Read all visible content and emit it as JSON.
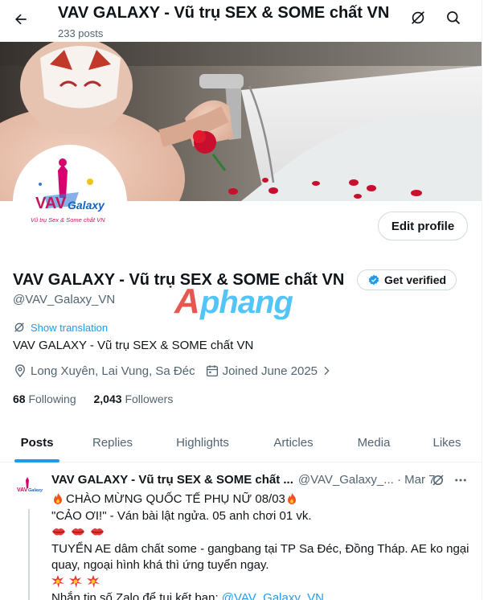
{
  "header": {
    "title": "VAV GALAXY - Vũ trụ SEX & SOME chất VN",
    "post_count": "233 posts"
  },
  "profile": {
    "name": "VAV GALAXY - Vũ trụ SEX & SOME chất VN",
    "handle": "@VAV_Galaxy_VN",
    "edit_label": "Edit profile",
    "get_verified_label": "Get verified",
    "show_translation": "Show translation",
    "bio": "VAV GALAXY - Vũ trụ SEX & SOME chất VN",
    "location": "Long Xuyên, Lai Vung, Sa Đéc",
    "joined": "Joined June 2025",
    "following_count": "68",
    "following_label": "Following",
    "followers_count": "2,043",
    "followers_label": "Followers",
    "avatar_logo_text": "VAV Galaxy",
    "avatar_logo_subtext": "Vũ trụ Sex & Some chất VN"
  },
  "watermark": "Aphang",
  "tabs": [
    "Posts",
    "Replies",
    "Highlights",
    "Articles",
    "Media",
    "Likes"
  ],
  "active_tab": "Posts",
  "tweet": {
    "name": "VAV GALAXY - Vũ trụ SEX & SOME chất ...",
    "handle_date": "@VAV_Galaxy_... · Mar 7",
    "lines": [
      "CHÀO MỪNG QUỐC TẾ PHỤ NỮ 08/03",
      "\"CẢO ƠI!\" - Ván bài lật ngửa. 05 anh chơi 01 vk.",
      "TUYỂN AE dâm chất some - gangbang tại TP Sa Đéc, Đồng Tháp. AE ko ngại",
      "quay, ngoại hình khá thì ứng tuyển ngay.",
      "Nhắn tin số Zalo để tui kết bạn: "
    ],
    "mention": "@VAV_Galaxy_VN"
  },
  "colors": {
    "accent": "#1d9bf0",
    "text": "#0f1419",
    "secondary": "#536471"
  }
}
